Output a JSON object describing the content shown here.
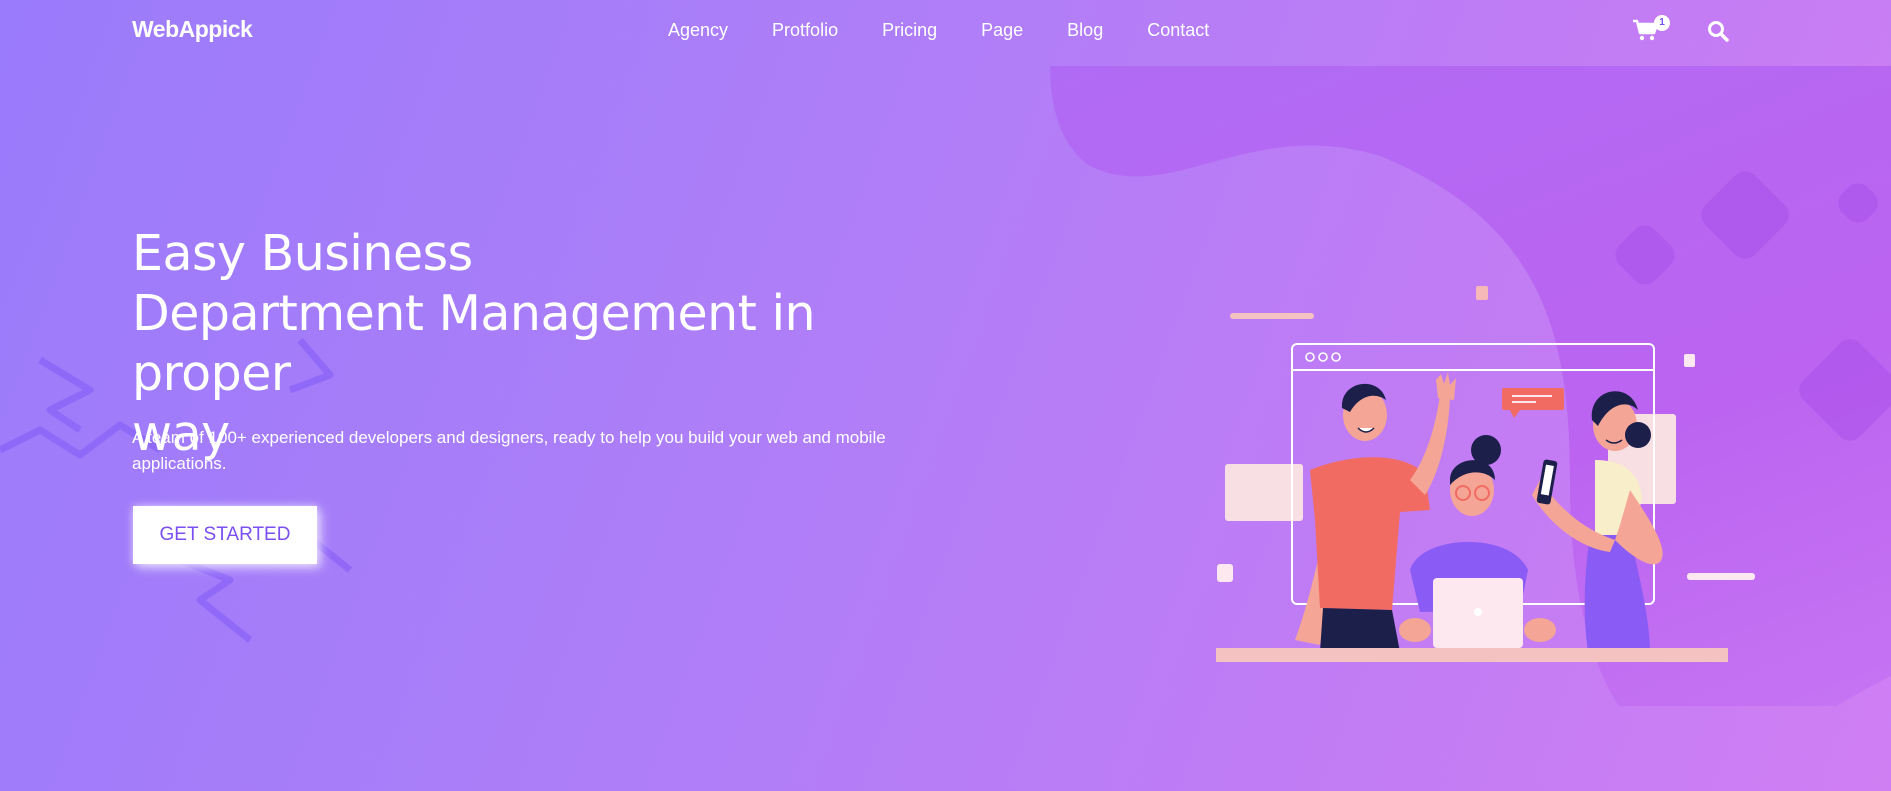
{
  "brand": {
    "logo_text": "WebAppick"
  },
  "nav": {
    "items": [
      {
        "label": "Agency"
      },
      {
        "label": "Protfolio"
      },
      {
        "label": "Pricing"
      },
      {
        "label": "Page"
      },
      {
        "label": "Blog"
      },
      {
        "label": "Contact"
      }
    ],
    "cart_count": "1",
    "icons": [
      "cart-icon",
      "search-icon"
    ]
  },
  "hero": {
    "title_lines": [
      "Easy Business",
      "Department Management in proper",
      "way"
    ],
    "subtitle": "A team of 100+ experienced developers and designers, ready to help you build your web and mobile applications.",
    "cta_label": "GET STARTED"
  },
  "colors": {
    "background_start": "#9a7bfb",
    "background_end": "#d07ff3",
    "accent": "#7b4ff0",
    "shirt_coral": "#f26b63",
    "shirt_purple": "#8a5cf5"
  }
}
